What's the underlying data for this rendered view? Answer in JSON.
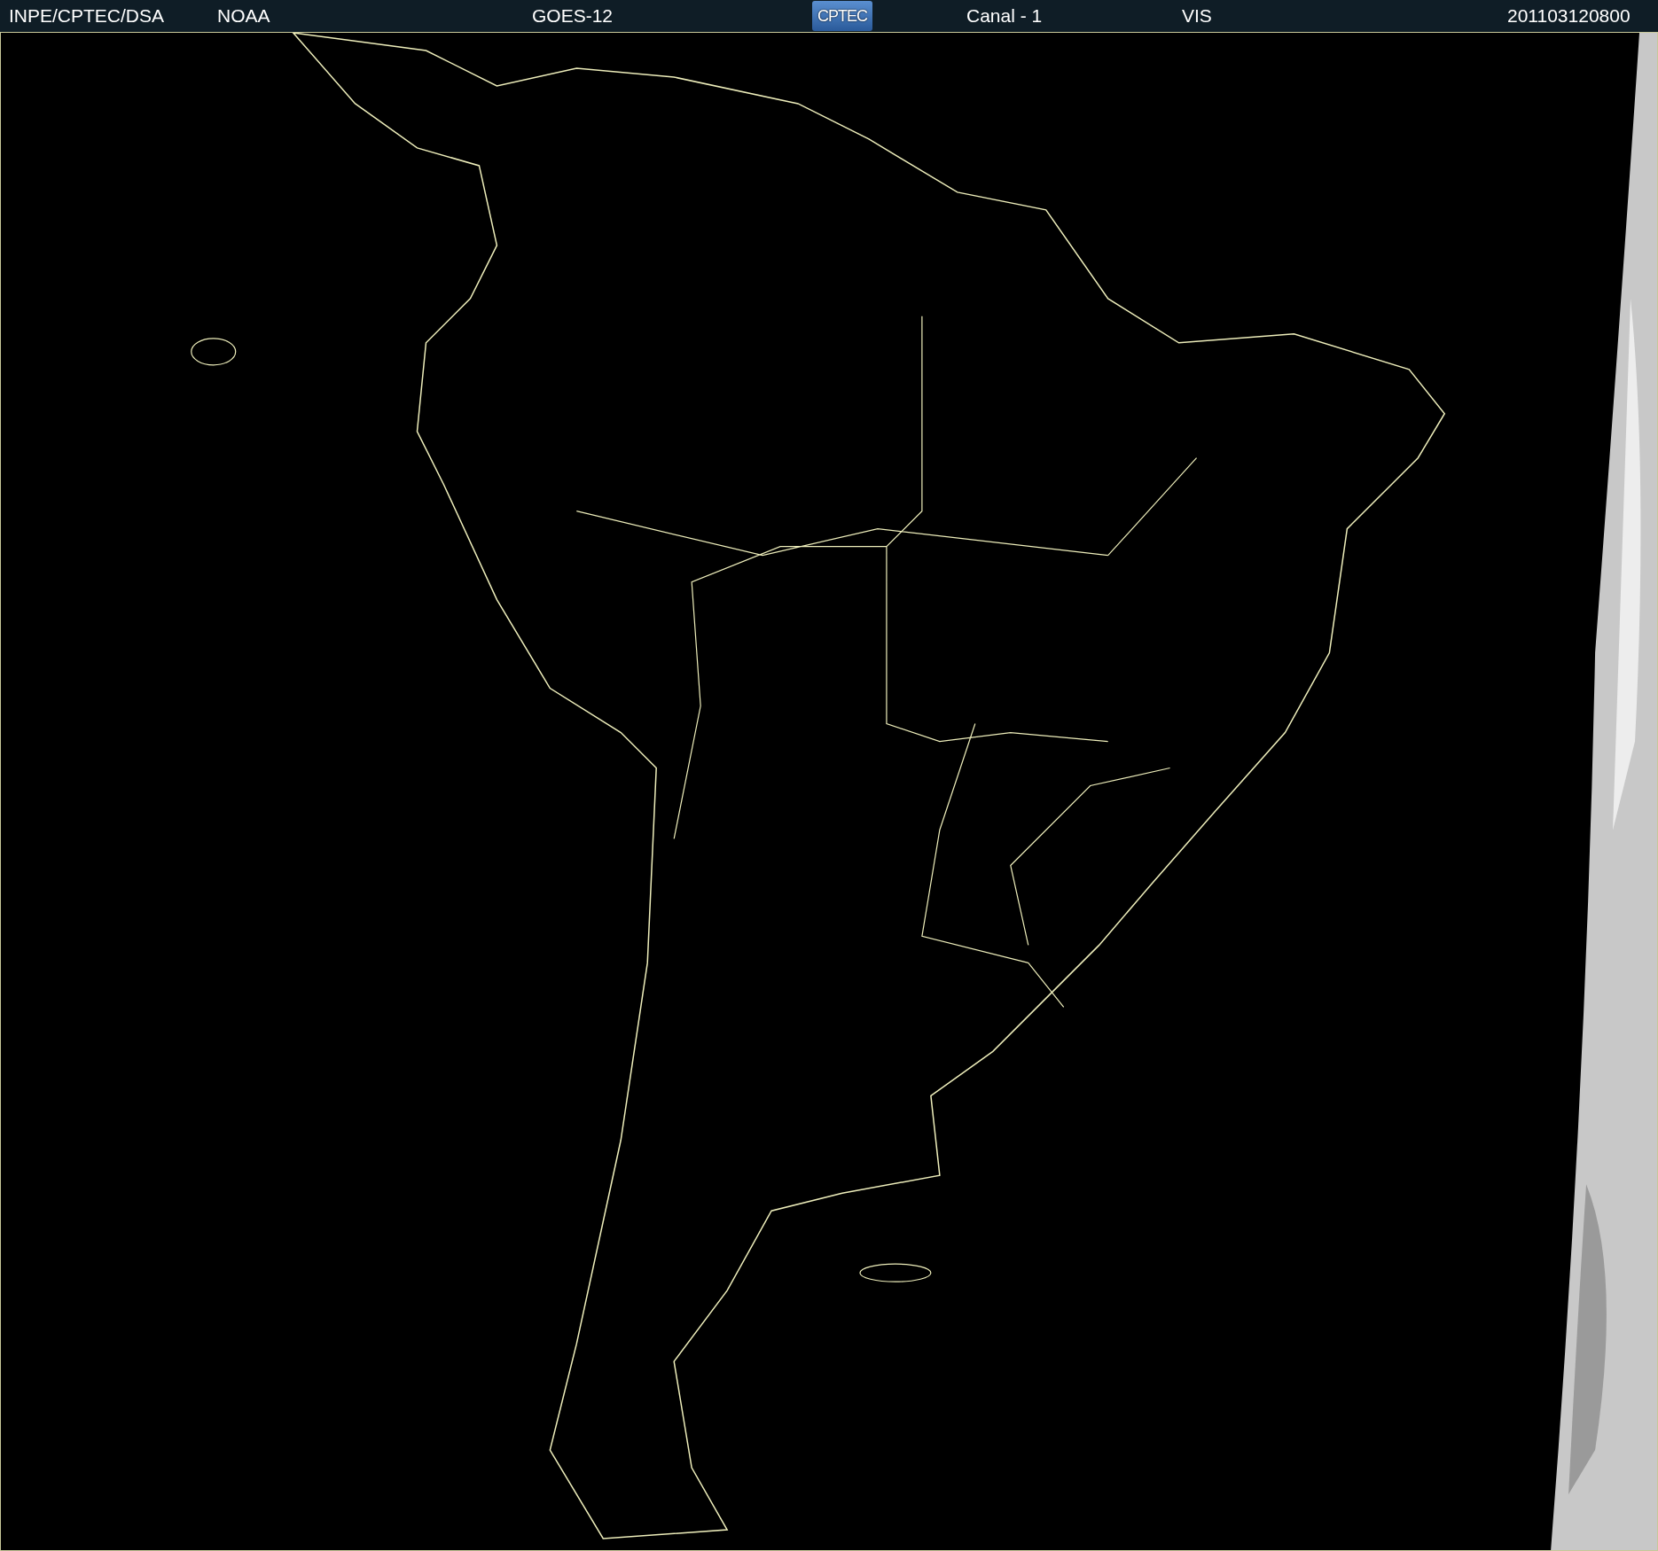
{
  "header": {
    "items": [
      {
        "kind": "text",
        "text": "INPE/CPTEC/DSA"
      },
      {
        "kind": "text",
        "text": "NOAA"
      },
      {
        "kind": "text",
        "text": "GOES-12"
      },
      {
        "kind": "logo",
        "text": "CPTEC"
      },
      {
        "kind": "text",
        "text": "Canal - 1"
      },
      {
        "kind": "text",
        "text": "VIS"
      },
      {
        "kind": "text",
        "text": "201103120800"
      }
    ]
  }
}
